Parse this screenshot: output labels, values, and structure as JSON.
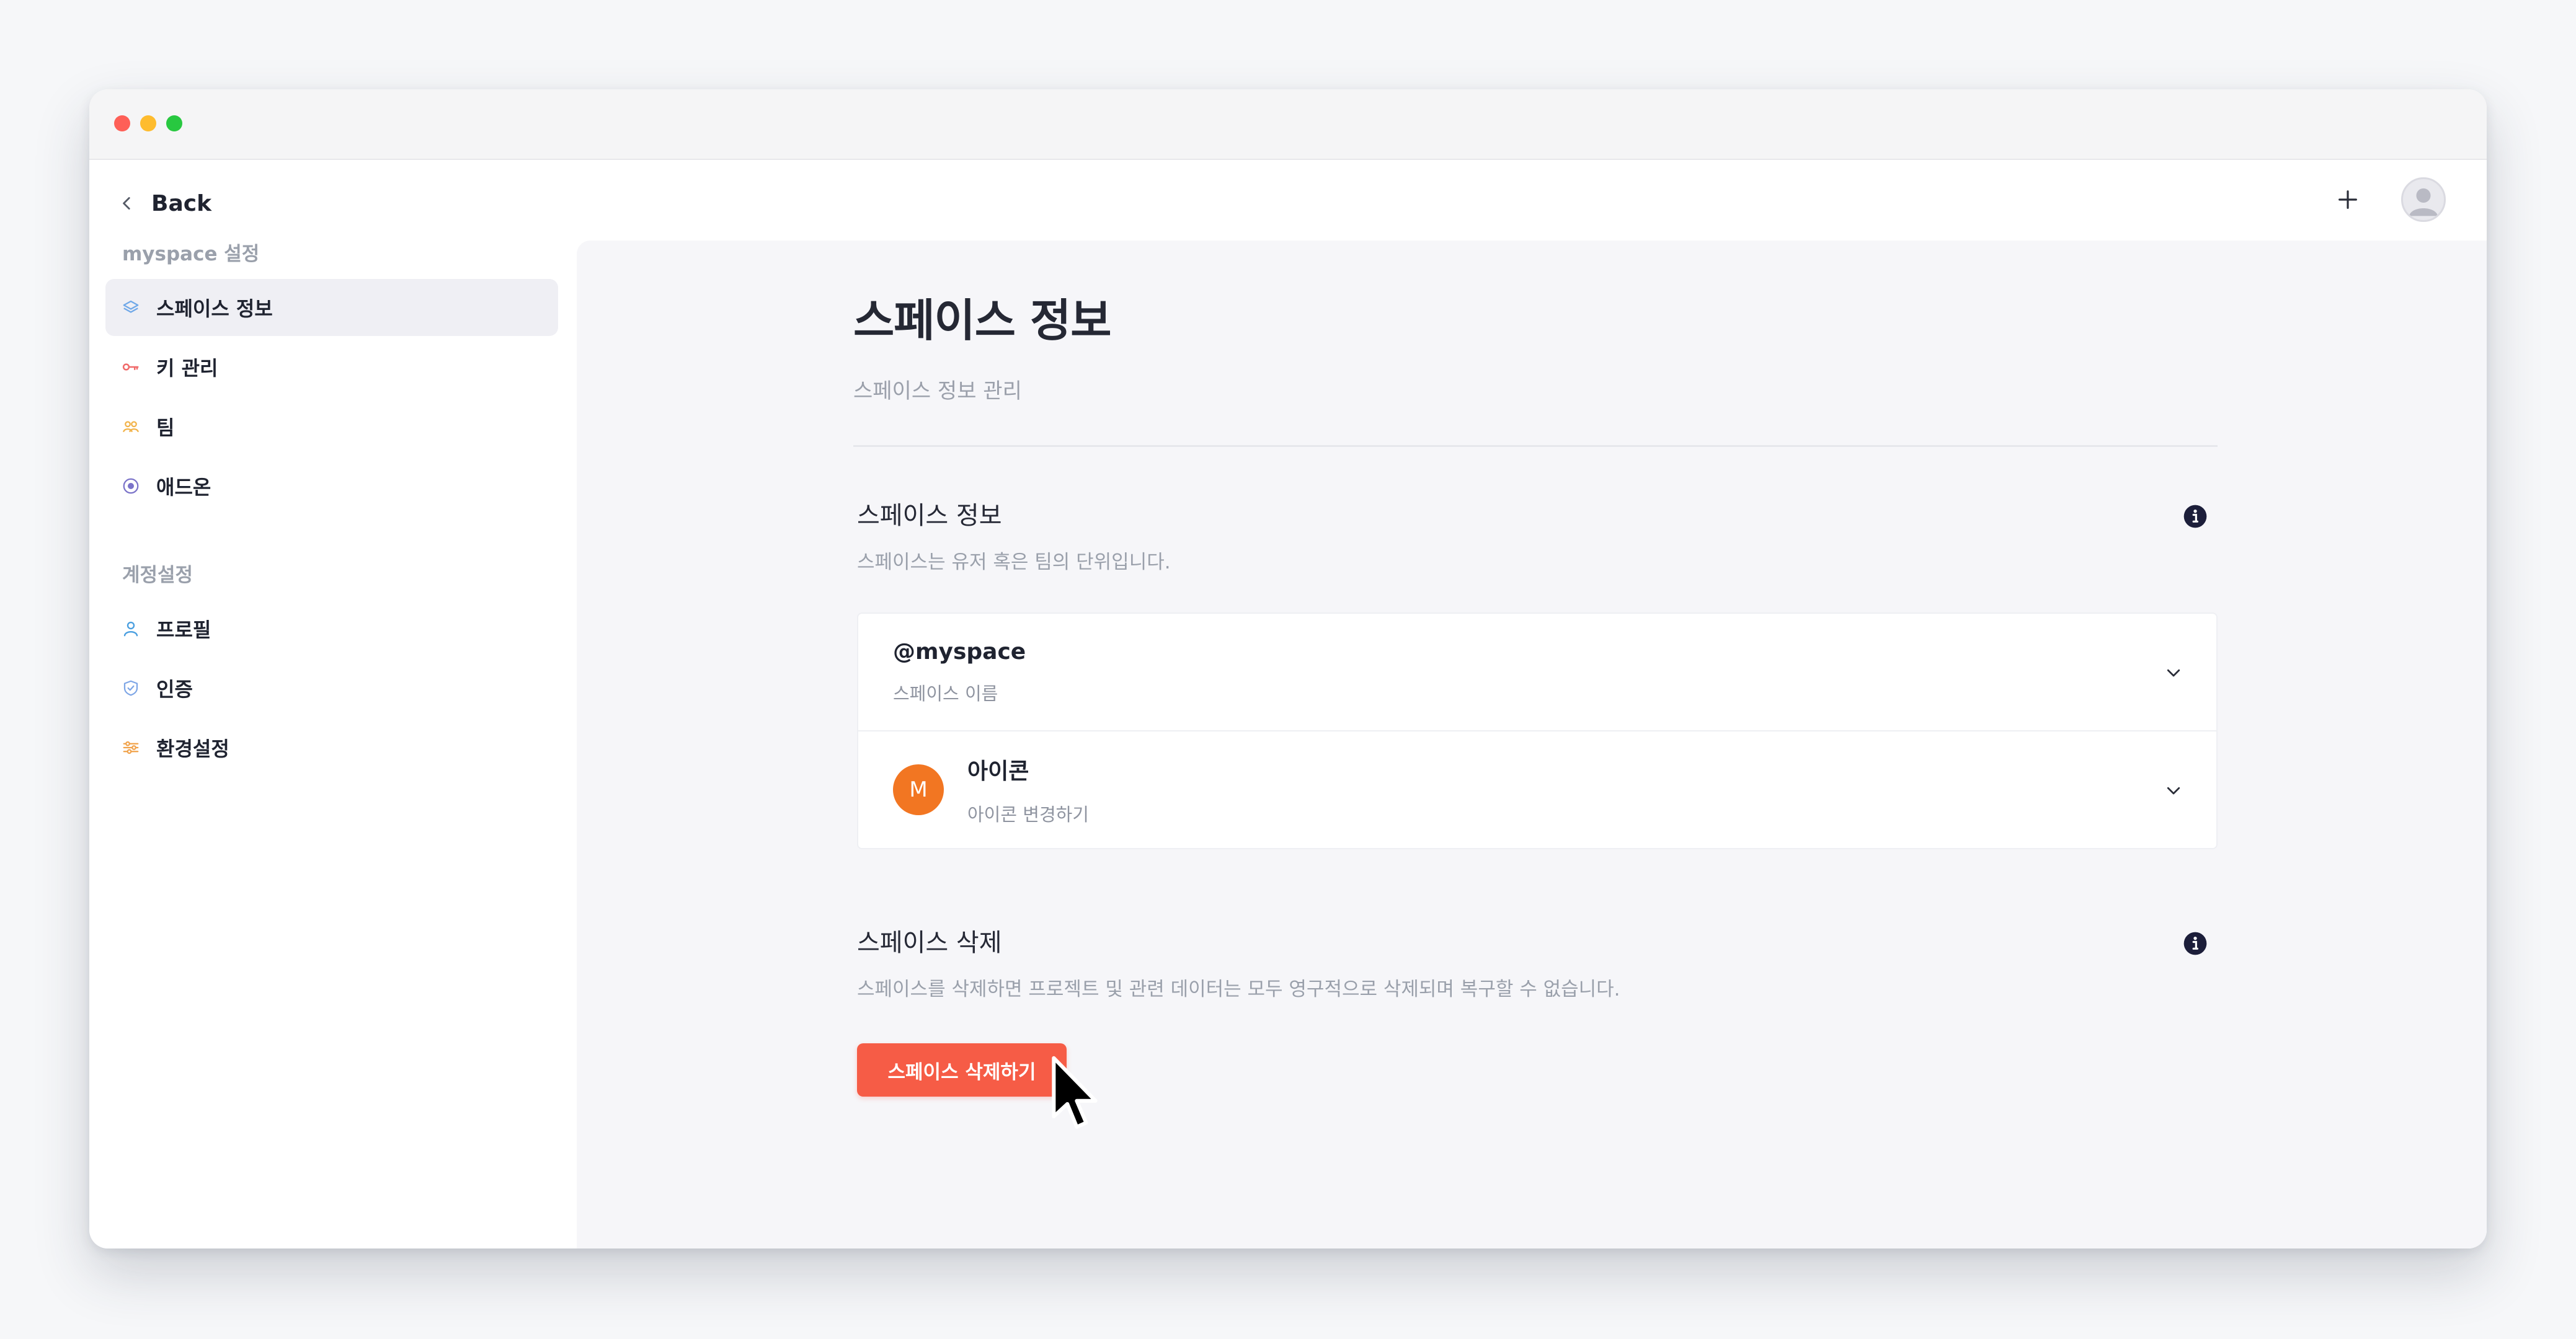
{
  "window": {
    "traffic_lights": [
      "close",
      "minimize",
      "zoom"
    ]
  },
  "topbar": {
    "back_label": "Back"
  },
  "sidebar": {
    "section1": "myspace 설정",
    "items1": [
      {
        "label": "스페이스 정보",
        "icon": "layers-icon",
        "color": "#6fa8e8"
      },
      {
        "label": "키 관리",
        "icon": "key-icon",
        "color": "#f06a6a"
      },
      {
        "label": "팀",
        "icon": "team-icon",
        "color": "#f2b34a"
      },
      {
        "label": "애드온",
        "icon": "addon-icon",
        "color": "#7b73c9"
      }
    ],
    "section2": "계정설정",
    "items2": [
      {
        "label": "프로필",
        "icon": "user-icon",
        "color": "#4a9fe0"
      },
      {
        "label": "인증",
        "icon": "shield-icon",
        "color": "#7ea6e6"
      },
      {
        "label": "환경설정",
        "icon": "settings-sliders-icon",
        "color": "#f1a24a"
      }
    ]
  },
  "main": {
    "title": "스페이스 정보",
    "subtitle": "스페이스 정보 관리",
    "info_section": {
      "title": "스페이스 정보",
      "desc": "스페이스는 유저 혹은 팀의 단위입니다."
    },
    "rows": [
      {
        "title": "@myspace",
        "sub": "스페이스 이름"
      },
      {
        "title": "아이콘",
        "sub": "아이콘 변경하기",
        "avatar_letter": "M",
        "avatar_color": "#f27622"
      }
    ],
    "delete_section": {
      "title": "스페이스 삭제",
      "desc": "스페이스를 삭제하면 프로젝트 및 관련 데이터는 모두 영구적으로 삭제되며 복구할 수 없습니다.",
      "button": "스페이스 삭제하기",
      "button_color": "#f65c46"
    }
  }
}
